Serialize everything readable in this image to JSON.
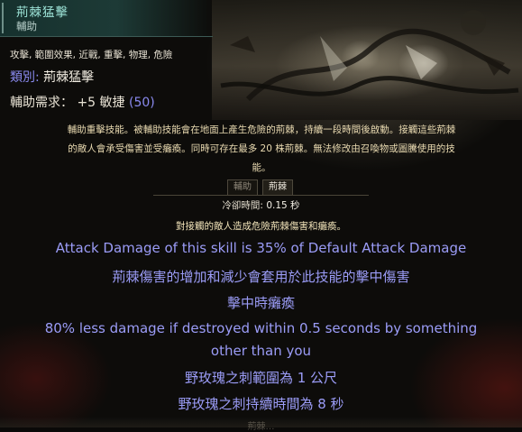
{
  "tooltip": {
    "title": "荊棘猛擊",
    "subtitle": "輔助",
    "tags": "攻擊, 範圍效果, 近戰, 重擊, 物理, 危險",
    "type_label": "類別:",
    "type_value": "荊棘猛擊",
    "requirement_label": "輔助需求：",
    "requirement_value": "+5 敏捷",
    "requirement_paren": "(50)",
    "description_lines": [
      "輔助重擊技能。被輔助技能會在地面上產生危險的荊棘，持續一段時間後啟動。接觸這些荊棘",
      "的敵人會承受傷害並受癱瘓。同時可存在最多 20 株荊棘。無法修改由召喚物或圖騰使用的技",
      "能。"
    ],
    "tabs": [
      "輔助",
      "荊棘"
    ],
    "cooldown_label": "冷卻時間:",
    "cooldown_value": "0.15 秒",
    "contact_text": "對接觸的敵人造成危險荊棘傷害和癱瘓。",
    "stats": [
      "Attack Damage of this skill is 35% of Default Attack Damage",
      "荊棘傷害的增加和減少會套用於此技能的擊中傷害",
      "擊中時癱瘓",
      "80% less damage if destroyed within 0.5 seconds by something",
      "other than you",
      "野玫瑰之刺範圍為 1 公尺",
      "野玫瑰之刺持續時間為 8 秒"
    ],
    "bottom_fade_text": "荊棘…"
  },
  "colors": {
    "title": "#9be1d5",
    "highlight": "#8a8aef",
    "stat": "#9b9cf7",
    "description": "#e8d9b0"
  },
  "icons": {
    "art": "thorn-art-image"
  }
}
